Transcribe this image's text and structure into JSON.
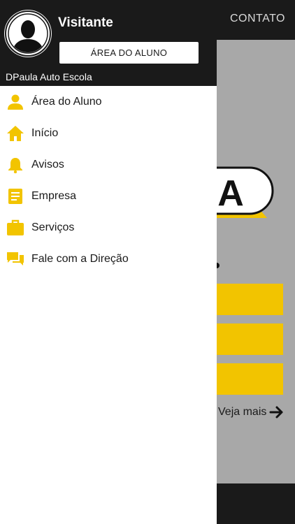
{
  "background": {
    "contact_label": "CONTATO",
    "see_more_label": "Veja mais",
    "logo_letter": "A"
  },
  "drawer": {
    "user_name": "Visitante",
    "student_area_button": "ÁREA DO ALUNO",
    "school_name": "DPaula Auto Escola",
    "items": [
      {
        "label": "Área do Aluno",
        "icon": "person-icon"
      },
      {
        "label": "Início",
        "icon": "home-icon"
      },
      {
        "label": "Avisos",
        "icon": "bell-icon"
      },
      {
        "label": "Empresa",
        "icon": "document-icon"
      },
      {
        "label": "Serviços",
        "icon": "briefcase-icon"
      },
      {
        "label": "Fale com a Direção",
        "icon": "chat-icon"
      }
    ]
  },
  "colors": {
    "accent": "#f2c400",
    "header": "#1a1a1a",
    "overlay": "#a8a8a8"
  }
}
